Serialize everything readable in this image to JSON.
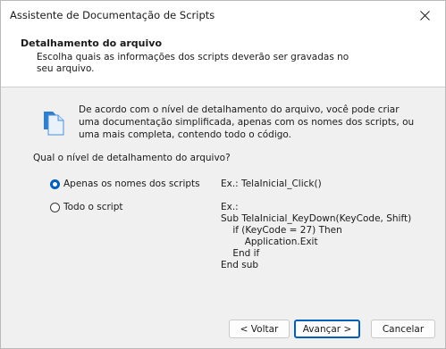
{
  "window": {
    "title": "Assistente de Documentação de Scripts",
    "close_icon": "close-icon"
  },
  "header": {
    "title": "Detalhamento do arquivo",
    "subtitle": "Escolha quais as informações dos scripts deverão ser gravadas no seu arquivo."
  },
  "body": {
    "info_icon": "document-icon",
    "info_text": "De acordo com o nível de detalhamento do arquivo, você pode criar uma documentação simplificada, apenas com os nomes dos scripts, ou uma mais completa, contendo todo o código.",
    "question": "Qual o nível de detalhamento do arquivo?",
    "options": [
      {
        "label": "Apenas os nomes dos scripts",
        "selected": true,
        "example_lines": [
          "Ex.: TelaInicial_Click()"
        ]
      },
      {
        "label": "Todo o script",
        "selected": false,
        "example_lines": [
          "Ex.:",
          "Sub TelaInicial_KeyDown(KeyCode, Shift)",
          "    if (KeyCode = 27) Then",
          "        Application.Exit",
          "    End if",
          "End sub"
        ]
      }
    ]
  },
  "buttons": {
    "back": "< Voltar",
    "next": "Avançar >",
    "cancel": "Cancelar"
  },
  "colors": {
    "accent": "#005fb8",
    "window_bg": "#f0f0f0",
    "header_bg": "#ffffff"
  }
}
